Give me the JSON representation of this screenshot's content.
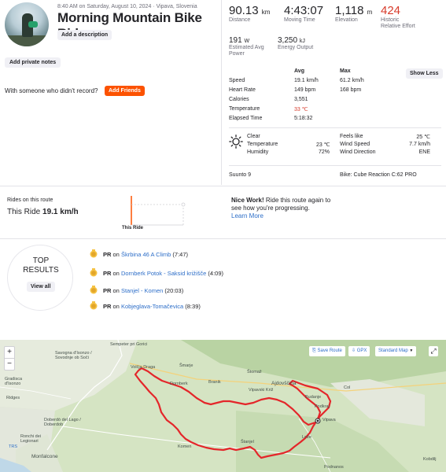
{
  "activity": {
    "meta": "8:40 AM on Saturday, August 10, 2024 · Vipava, Slovenia",
    "title": "Morning Mountain Bike Ride",
    "add_description": "Add a description",
    "add_private_notes": "Add private notes",
    "with_someone": "With someone who didn't record?",
    "add_friends": "Add Friends"
  },
  "stats": {
    "distance": {
      "value": "90.13",
      "unit": "km",
      "label": "Distance"
    },
    "moving_time": {
      "value": "4:43:07",
      "label": "Moving Time"
    },
    "elevation": {
      "value": "1,118",
      "unit": "m",
      "label": "Elevation"
    },
    "relative_effort": {
      "value": "424",
      "label1": "Historic",
      "label2": "Relative Effort"
    },
    "avg_power": {
      "value": "191",
      "unit": "W",
      "label1": "Estimated Avg",
      "label2": "Power"
    },
    "energy": {
      "value": "3,250",
      "unit": "kJ",
      "label": "Energy Output"
    }
  },
  "table": {
    "header_avg": "Avg",
    "header_max": "Max",
    "show_less": "Show Less",
    "rows": [
      {
        "label": "Speed",
        "avg": "19.1 km/h",
        "max": "61.2 km/h"
      },
      {
        "label": "Heart Rate",
        "avg": "149 bpm",
        "max": "168 bpm"
      },
      {
        "label": "Calories",
        "avg": "3,551",
        "max": ""
      },
      {
        "label": "Temperature",
        "avg": "33 ℃",
        "max": ""
      },
      {
        "label": "Elapsed Time",
        "avg": "5:18:32",
        "max": ""
      }
    ]
  },
  "weather": {
    "condition": "Clear",
    "temperature_label": "Temperature",
    "temperature": "23 ℃",
    "humidity_label": "Humidity",
    "humidity": "72%",
    "feels_like_label": "Feels like",
    "feels_like": "25 ℃",
    "wind_speed_label": "Wind Speed",
    "wind_speed": "7.7 km/h",
    "wind_dir_label": "Wind Direction",
    "wind_dir": "ENE"
  },
  "device": "Suunto 9",
  "bike": "Bike: Cube Reaction C:62 PRO",
  "route": {
    "rides_label": "Rides on this route",
    "this_ride_label": "This Ride",
    "this_ride_value": "19.1 km/h",
    "chart_label": "This Ride",
    "nice_work": "Nice Work!",
    "nice_text": "Ride this route again to see how you're progressing.",
    "learn_more": "Learn More"
  },
  "top_results": {
    "title_line1": "TOP",
    "title_line2": "RESULTS",
    "view_all": "View all",
    "items": [
      {
        "pr": "PR",
        "on": "on",
        "segment": "Škrbina 46 A Climb",
        "time": "(7:47)"
      },
      {
        "pr": "PR",
        "on": "on",
        "segment": "Dornberk Potok - Saksid križišče",
        "time": "(4:09)"
      },
      {
        "pr": "PR",
        "on": "on",
        "segment": "Stanjel - Komen",
        "time": "(20:03)"
      },
      {
        "pr": "PR",
        "on": "on",
        "segment": "Kobjeglava-Tomačevica",
        "time": "(8:39)"
      }
    ]
  },
  "map": {
    "zoom_in": "+",
    "zoom_out": "−",
    "save_route": "Save Route",
    "gpx": "GPX",
    "map_type": "Standard Map",
    "places": [
      "Sempeter pri Gorici",
      "Savogna d'Isonzo / Sovodnje ob Soči",
      "Gradisca d'Isonzo",
      "Ridges",
      "Doberdò del Lago / Doberdob",
      "Ronchi dei Legionari",
      "TRS",
      "Monfalcone",
      "Volčja Draga",
      "Dornberk",
      "Šmarje",
      "Branik",
      "Štomaž",
      "Vipavski Križ",
      "Ajdovščina",
      "Col",
      "Budanje",
      "Podkraj",
      "Vipava",
      "Lože",
      "Komen",
      "Štanjel",
      "Podnanos",
      "Kobdilj"
    ],
    "route_color": "#e4262a"
  }
}
